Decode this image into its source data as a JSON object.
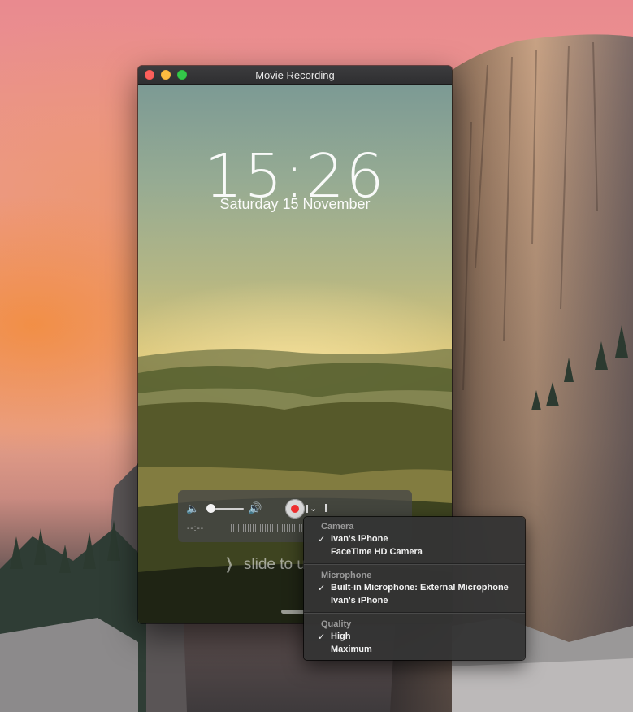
{
  "window": {
    "title": "Movie Recording",
    "traffic_lights": [
      "close",
      "minimize",
      "maximize"
    ]
  },
  "phone_screen": {
    "clock": "15:26",
    "date": "Saturday 15 November",
    "slide_text": "slide to u"
  },
  "controls": {
    "elapsed_time": "--:--",
    "volume_level": 0.05,
    "record_color": "#ef2f2f"
  },
  "menu": {
    "sections": [
      {
        "header": "Camera",
        "items": [
          {
            "label": "Ivan's iPhone",
            "checked": true,
            "check": "✓"
          },
          {
            "label": "FaceTime HD Camera",
            "checked": false,
            "check": ""
          }
        ]
      },
      {
        "header": "Microphone",
        "items": [
          {
            "label": "Built-in Microphone: External Microphone",
            "checked": true,
            "check": "✓"
          },
          {
            "label": "Ivan's iPhone",
            "checked": false,
            "check": ""
          }
        ]
      },
      {
        "header": "Quality",
        "items": [
          {
            "label": "High",
            "checked": true,
            "check": "✓"
          },
          {
            "label": "Maximum",
            "checked": false,
            "check": ""
          }
        ]
      }
    ]
  },
  "colors": {
    "menu_bg": "#343434",
    "menu_header": "#9a9a9a",
    "titlebar": "#2f2f31"
  }
}
